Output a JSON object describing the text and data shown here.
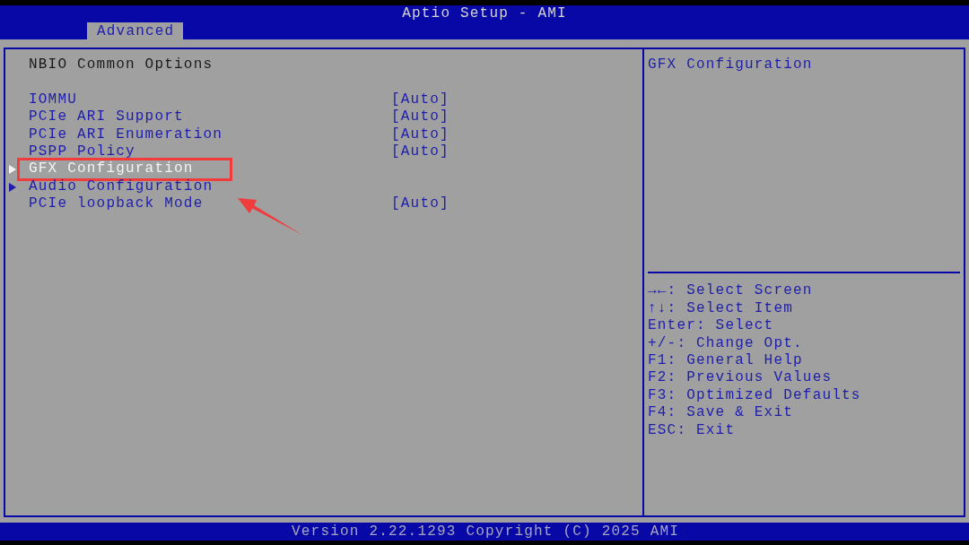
{
  "window": {
    "title": "Aptio Setup - AMI"
  },
  "tabs": [
    {
      "label": "Advanced",
      "selected": true
    }
  ],
  "menu": {
    "heading": "NBIO Common Options",
    "items": [
      {
        "label": "IOMMU",
        "value": "[Auto]",
        "kind": "option",
        "selected": false,
        "highlighted": false
      },
      {
        "label": "PCIe ARI Support",
        "value": "[Auto]",
        "kind": "option",
        "selected": false,
        "highlighted": false
      },
      {
        "label": "PCIe ARI Enumeration",
        "value": "[Auto]",
        "kind": "option",
        "selected": false,
        "highlighted": false
      },
      {
        "label": "PSPP Policy",
        "value": "[Auto]",
        "kind": "option",
        "selected": false,
        "highlighted": false
      },
      {
        "label": "GFX Configuration",
        "kind": "submenu",
        "selected": true,
        "highlighted": true
      },
      {
        "label": "Audio Configuration",
        "kind": "submenu",
        "selected": false,
        "highlighted": false
      },
      {
        "label": "PCIe loopback Mode",
        "value": "[Auto]",
        "kind": "option",
        "selected": false,
        "highlighted": false
      }
    ]
  },
  "help": {
    "description": "GFX Configuration",
    "keys": [
      "→←: Select Screen",
      "↑↓: Select Item",
      "Enter: Select",
      "+/-: Change Opt.",
      "F1: General Help",
      "F2: Previous Values",
      "F3: Optimized Defaults",
      "F4: Save & Exit",
      "ESC: Exit"
    ]
  },
  "status_bar": {
    "version": "Version 2.22.1293 Copyright (C) 2025 AMI"
  }
}
